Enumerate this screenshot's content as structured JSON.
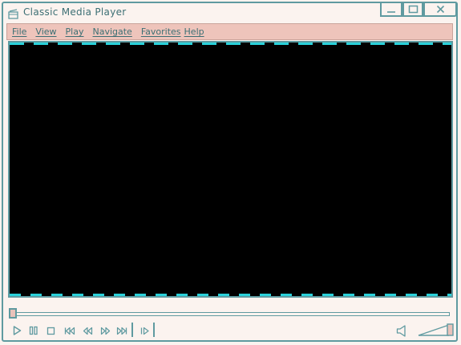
{
  "window": {
    "title": "Classic Media Player",
    "controls": [
      "minimize-icon",
      "maximize-icon",
      "close-icon"
    ]
  },
  "menubar": {
    "items": [
      {
        "label": "File"
      },
      {
        "label": "View"
      },
      {
        "label": "Play"
      },
      {
        "label": "Navigate"
      },
      {
        "label": "Favorites"
      },
      {
        "label": "Help"
      }
    ]
  },
  "playback": {
    "seek_position": 0,
    "volume_level": 1.0
  },
  "controls": [
    "play-icon",
    "pause-icon",
    "stop-icon",
    "skip-back-icon",
    "rewind-icon",
    "fast-forward-icon",
    "skip-forward-icon",
    "frame-step-icon",
    "speaker-icon"
  ],
  "colors": {
    "accent": "#5f9aa0",
    "menubar_bg": "#eec4bb",
    "window_bg": "#fbf3ef",
    "video_bg": "#000000",
    "video_edge": "#2ad1da"
  }
}
